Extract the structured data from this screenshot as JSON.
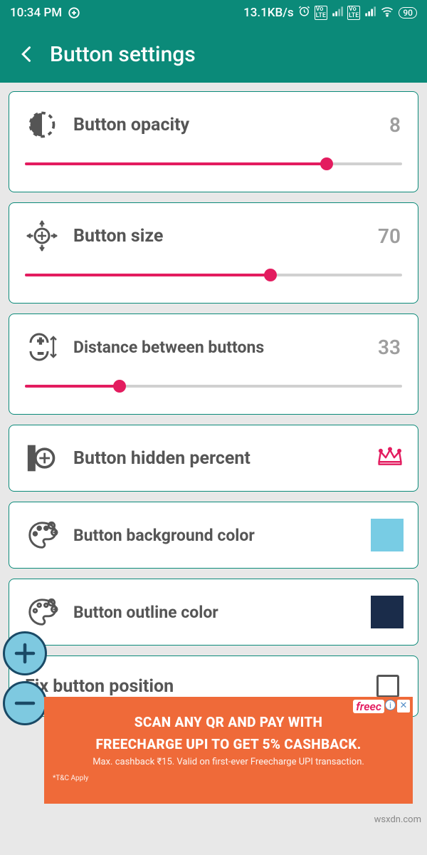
{
  "status": {
    "time": "10:34 PM",
    "net_speed": "13.1KB/s",
    "battery": "90"
  },
  "header": {
    "title": "Button settings"
  },
  "settings": {
    "opacity": {
      "label": "Button opacity",
      "value": "8",
      "pct": 80
    },
    "size": {
      "label": "Button size",
      "value": "70",
      "pct": 65
    },
    "distance": {
      "label": "Distance between buttons",
      "value": "33",
      "pct": 25
    },
    "hidden": {
      "label": "Button hidden percent"
    },
    "bg_color": {
      "label": "Button background color",
      "color": "#78cce4"
    },
    "outline_color": {
      "label": "Button outline color",
      "color": "#1a2c4a"
    },
    "fix_pos": {
      "label": "Fix button position",
      "checked": false
    }
  },
  "ad": {
    "brand": "freec",
    "headline1": "SCAN ANY QR AND PAY WITH",
    "headline2": "FREECHARGE UPI TO GET 5% CASHBACK.",
    "sub": "Max. cashback ₹15. Valid on first-ever Freecharge UPI transaction.",
    "tc": "*T&C Apply"
  },
  "watermark": "wsxdn.com"
}
